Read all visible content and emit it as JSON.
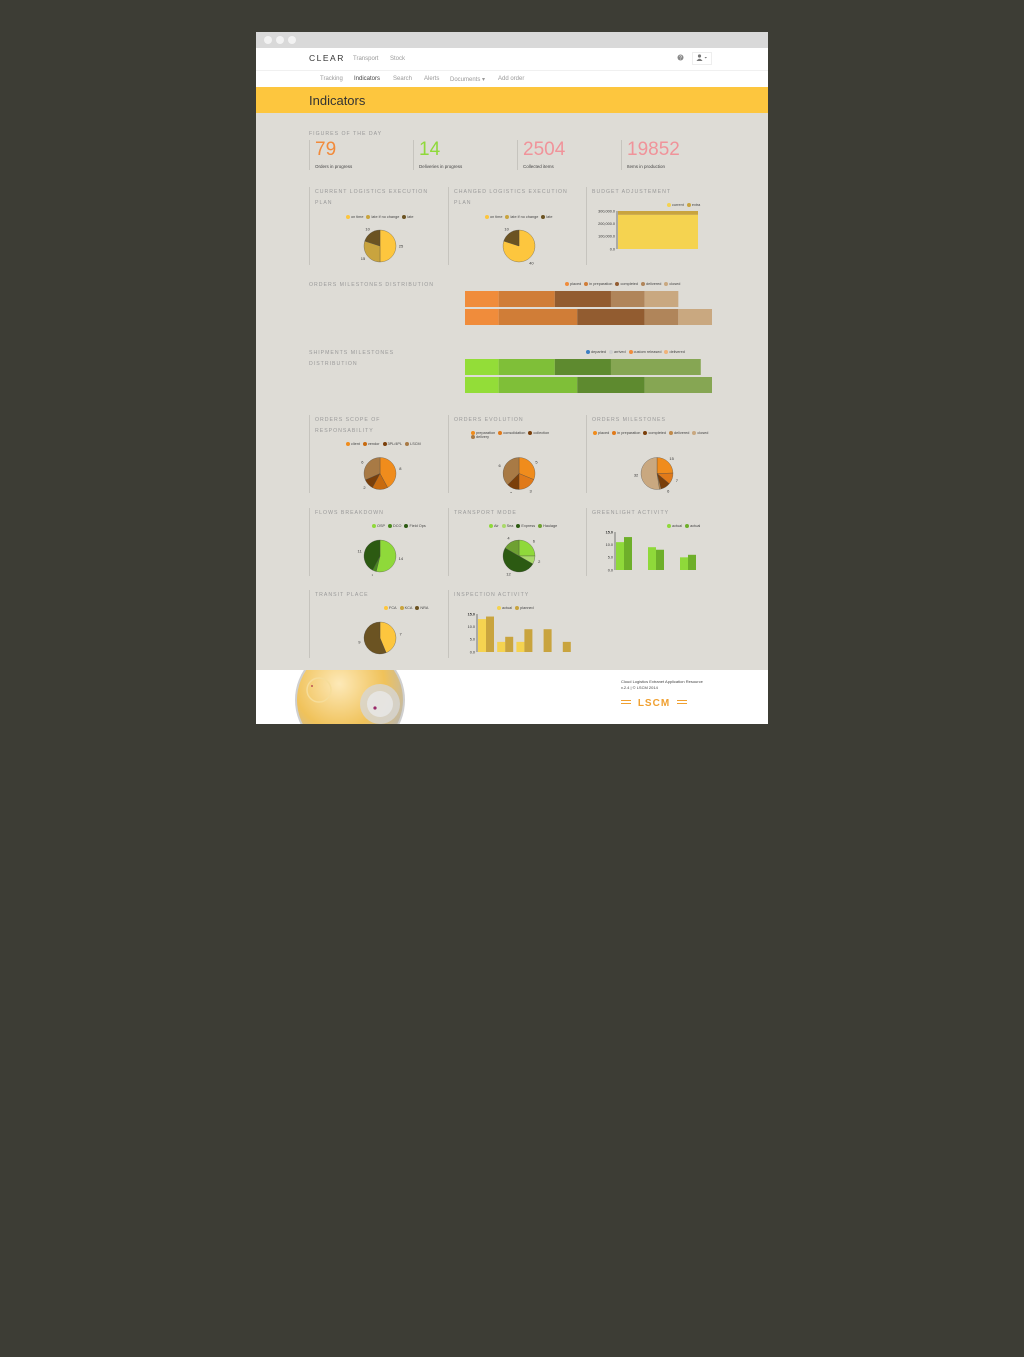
{
  "nav": {
    "brand": "CLEAR",
    "top_links": [
      "Transport",
      "Stock"
    ],
    "help_icon": "question-circle-icon",
    "user_icon": "user-icon",
    "tabs": [
      "Tracking",
      "Indicators",
      "Search",
      "Alerts",
      "Documents ▾",
      "Add order"
    ],
    "active_tab": "Indicators"
  },
  "page": {
    "title": "Indicators"
  },
  "figures": {
    "heading": "FIGURES OF THE DAY",
    "items": [
      {
        "value": "79",
        "label": "Orders in progress",
        "color": "#f28a3a"
      },
      {
        "value": "14",
        "label": "Deliveries in progress",
        "color": "#8fd93a"
      },
      {
        "value": "2504",
        "label": "Collected items",
        "color": "#f0939a"
      },
      {
        "value": "19852",
        "label": "Items in production",
        "color": "#f0939a"
      }
    ]
  },
  "sections": {
    "orders_dist": [
      "ORDERS MILESTONES DISTRIBUTION"
    ],
    "shipments_dist": [
      "SHIPMENTS MILESTONES",
      "DISTRIBUTION"
    ]
  },
  "chart_data": [
    {
      "id": "cur-plan",
      "type": "pie",
      "title": [
        "CURRENT LOGISTICS EXECUTION",
        "PLAN"
      ],
      "legend": [
        "on time",
        "late if no change",
        "late"
      ],
      "colors": [
        "#fdc63e",
        "#c9a43e",
        "#6b5322"
      ],
      "values": [
        25,
        15,
        10
      ]
    },
    {
      "id": "chg-plan",
      "type": "pie",
      "title": [
        "CHANGED LOGISTICS EXECUTION",
        "PLAN"
      ],
      "legend": [
        "on time",
        "late if no change",
        "late"
      ],
      "colors": [
        "#fdc63e",
        "#c9a43e",
        "#6b5322"
      ],
      "values": [
        40,
        0,
        10
      ]
    },
    {
      "id": "budget",
      "type": "bar",
      "title": [
        "BUDGET ADJUSTEMENT"
      ],
      "legend": [
        "current",
        "extra"
      ],
      "colors": [
        "#f5d350",
        "#c9a43e"
      ],
      "ytick_labels": [
        "300,000.0",
        "200,000.0",
        "100,000.0",
        "0.0"
      ],
      "ylim": [
        0,
        300000
      ],
      "series": [
        {
          "name": "current",
          "values": [
            270000
          ]
        },
        {
          "name": "extra",
          "values": [
            30000
          ]
        }
      ]
    },
    {
      "id": "orders-ms-dist",
      "type": "bar",
      "legend": [
        "placed",
        "in preparation",
        "completed",
        "delivered",
        "closed"
      ],
      "colors": [
        "#f08c3b",
        "#d07d37",
        "#925c30",
        "#b0855a",
        "#c9a880"
      ],
      "rows": [
        [
          3,
          5,
          5,
          3,
          3
        ],
        [
          3,
          7,
          6,
          3,
          3
        ]
      ]
    },
    {
      "id": "ship-ms-dist",
      "type": "bar",
      "legend": [
        "departed",
        "arrived",
        "custom released",
        "delivered"
      ],
      "colors": [
        "#3c7fc2",
        "#cfcfcf",
        "#f08c3b",
        "#f0b37a"
      ],
      "bar_colors": [
        "#93dd38",
        "#7fbf38",
        "#5e8a2f",
        "#86a653"
      ],
      "rows": [
        [
          3,
          5,
          5,
          8
        ],
        [
          3,
          7,
          6,
          6
        ]
      ]
    },
    {
      "id": "scope",
      "type": "pie",
      "title": [
        "ORDERS SCOPE OF",
        "RESPONSABILITY"
      ],
      "legend": [
        "client",
        "vendor",
        "3PL/4PL",
        "LSCM"
      ],
      "colors": [
        "#f08c1c",
        "#c86b0f",
        "#7a3f0a",
        "#a87a45"
      ],
      "values": [
        8,
        3,
        2,
        6
      ]
    },
    {
      "id": "orders-evo",
      "type": "pie",
      "title": [
        "ORDERS EVOLUTION"
      ],
      "legend": [
        "preparation",
        "consolidation",
        "collection",
        "delivery"
      ],
      "colors": [
        "#f08c1c",
        "#e07a1a",
        "#7a3f0a",
        "#a87a45"
      ],
      "values": [
        5,
        3,
        2,
        6
      ]
    },
    {
      "id": "orders-ms",
      "type": "pie",
      "title": [
        "ORDERS MILESTONES"
      ],
      "legend": [
        "placed",
        "in preparation",
        "completed",
        "delivered",
        "closed"
      ],
      "colors": [
        "#f08c1c",
        "#e07a1a",
        "#7a3f0a",
        "#c08a4a",
        "#c9a880"
      ],
      "values": [
        15,
        7,
        6,
        1,
        32
      ]
    },
    {
      "id": "flows",
      "type": "pie",
      "title": [
        "FLOWS BREAKDOWN"
      ],
      "legend": [
        "OSP",
        "DCO",
        "Field Ops"
      ],
      "colors": [
        "#8fd93a",
        "#4a8a1e",
        "#2c5a12"
      ],
      "values": [
        14,
        1,
        11
      ]
    },
    {
      "id": "transport",
      "type": "pie",
      "title": [
        "TRANSPORT MODE"
      ],
      "legend": [
        "Air",
        "Sea",
        "Express",
        "Haulage"
      ],
      "colors": [
        "#8fd93a",
        "#a9d96a",
        "#2c5a12",
        "#6ea032"
      ],
      "values": [
        6,
        2,
        12,
        4
      ]
    },
    {
      "id": "greenlight",
      "type": "bar",
      "title": [
        "GREENLIGHT ACTIVITY"
      ],
      "legend": [
        "actual",
        "actual"
      ],
      "colors": [
        "#8fd93a",
        "#6eaf2a"
      ],
      "ytick_labels": [
        "15.0",
        "10.0",
        "5.0",
        "0.0"
      ],
      "ylim": [
        0,
        15
      ],
      "series": [
        {
          "name": "actual",
          "values": [
            11,
            9,
            5
          ]
        },
        {
          "name": "actual",
          "values": [
            13,
            8,
            6
          ]
        }
      ]
    },
    {
      "id": "transit",
      "type": "pie",
      "title": [
        "TRANSIT PLACE"
      ],
      "legend": [
        "FCA",
        "KCA",
        "NRA"
      ],
      "colors": [
        "#fdc63e",
        "#c9a43e",
        "#6b5322"
      ],
      "values": [
        7,
        0,
        9
      ]
    },
    {
      "id": "inspection",
      "type": "bar",
      "title": [
        "INSPECTION ACTIVITY"
      ],
      "legend": [
        "actual",
        "planned"
      ],
      "colors": [
        "#f5d350",
        "#c9a43e"
      ],
      "ytick_labels": [
        "15.0",
        "10.0",
        "5.0",
        "0.0"
      ],
      "ylim": [
        0,
        15
      ],
      "series": [
        {
          "name": "actual",
          "values": [
            13,
            4,
            4,
            0,
            0
          ]
        },
        {
          "name": "planned",
          "values": [
            14,
            6,
            9,
            9,
            4
          ]
        }
      ]
    }
  ],
  "footer": {
    "line1": "Cloud Logistics Extranet Application Resource",
    "line2": "v.2.4 | © LSCM 2014",
    "brand": "LSCM"
  }
}
